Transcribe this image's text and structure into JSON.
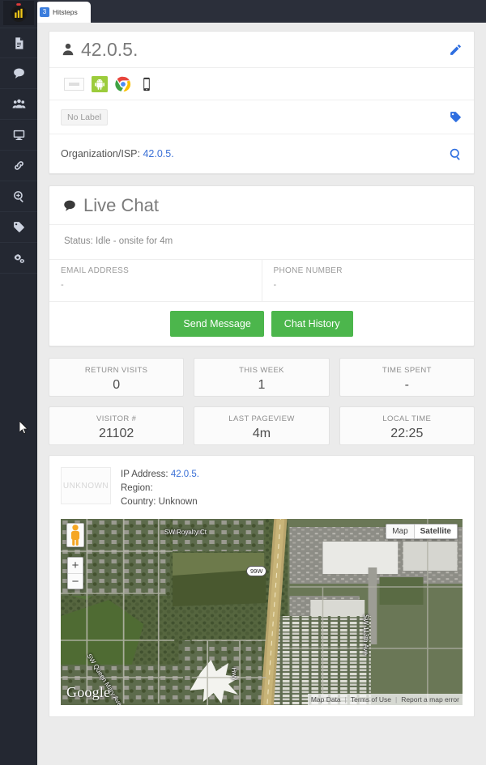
{
  "browser": {
    "tab": {
      "favicon_badge": "3",
      "title": "Hitsteps"
    }
  },
  "sidebar": {
    "logo_name": "hitsteps-logo",
    "items": [
      {
        "icon": "document-icon",
        "label": "Reports"
      },
      {
        "icon": "chat-bubble-icon",
        "label": "Live Chat"
      },
      {
        "icon": "users-icon",
        "label": "Visitors"
      },
      {
        "icon": "monitor-icon",
        "label": "Realtime"
      },
      {
        "icon": "link-icon",
        "label": "Links"
      },
      {
        "icon": "search-plus-icon",
        "label": "Analytics"
      },
      {
        "icon": "tag-icon",
        "label": "Labels"
      },
      {
        "icon": "gears-icon",
        "label": "Settings"
      }
    ]
  },
  "profile": {
    "name": "42.0.5.",
    "edit_icon": "pencil-icon",
    "person_icon": "person-icon",
    "tech_icons": [
      {
        "name": "flag-unknown-icon",
        "title": "Unknown country"
      },
      {
        "name": "android-icon",
        "title": "Android"
      },
      {
        "name": "chrome-icon",
        "title": "Chrome"
      },
      {
        "name": "mobile-device-icon",
        "title": "Mobile"
      }
    ],
    "label_chip": "No Label",
    "label_icon": "tag-icon",
    "organization_label": "Organization/ISP:",
    "organization_value": "42.0.5.",
    "search_icon": "search-icon"
  },
  "live_chat": {
    "title": "Live Chat",
    "title_icon": "chat-bubble-icon",
    "status": "Status: Idle - onsite for 4m",
    "email_label": "EMAIL ADDRESS",
    "email_value": "-",
    "phone_label": "PHONE NUMBER",
    "phone_value": "-",
    "send_message_button": "Send Message",
    "chat_history_button": "Chat History"
  },
  "stats": [
    {
      "title": "RETURN VISITS",
      "value": "0"
    },
    {
      "title": "THIS WEEK",
      "value": "1"
    },
    {
      "title": "TIME SPENT",
      "value": "-"
    },
    {
      "title": "VISITOR #",
      "value": "21102"
    },
    {
      "title": "LAST PAGEVIEW",
      "value": "4m"
    },
    {
      "title": "LOCAL TIME",
      "value": "22:25"
    }
  ],
  "location": {
    "thumb_text": "UNKNOWN",
    "ip_label": "IP Address:",
    "ip_value": "42.0.5.",
    "region_label": "Region:",
    "region_value": "",
    "country_label": "Country:",
    "country_value": "Unknown",
    "map": {
      "type_buttons": [
        {
          "label": "Map",
          "active": false
        },
        {
          "label": "Satellite",
          "active": true
        }
      ],
      "pegman_icon": "street-view-pegman-icon",
      "zoom_in": "+",
      "zoom_out": "−",
      "provider_logo": "Google",
      "attribution": [
        "Map Data",
        "Terms of Use",
        "Report a map error"
      ],
      "street_labels": [
        "SW Royalty Ct",
        "SW 113th Ave",
        "SW Queen Mary Ave",
        "Hwy"
      ],
      "highway_shield": "99W"
    }
  },
  "colors": {
    "sidebar_bg": "#242832",
    "accent_blue": "#2f6fe0",
    "link_blue": "#3a70d6",
    "button_green": "#4cb64c",
    "page_bg": "#ebebeb"
  }
}
